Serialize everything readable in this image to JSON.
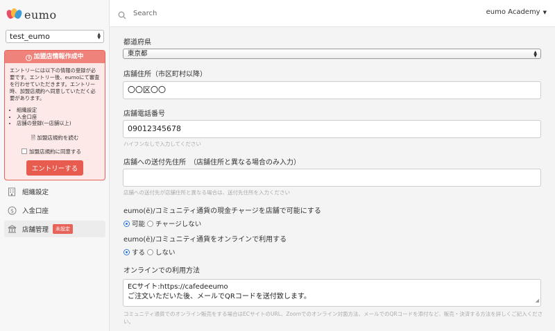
{
  "brand": {
    "name": "eumo"
  },
  "sidebar": {
    "org_select": "test_eumo",
    "notice": {
      "title": "加盟店情報作成中",
      "body": "エントリーには以下の情報の登録が必要です。エントリー後、eumoにて審査を行わせていただきます。エントリー時、加盟店規約へ同意していただく必要があります。",
      "items": [
        "組織設定",
        "入金口座",
        "店舗の登録(一店舗以上)"
      ],
      "terms_link": "加盟店規約を読む",
      "agree_label": "加盟店規約に同意する",
      "entry_button": "エントリーする"
    },
    "nav": [
      {
        "label": "組織設定",
        "icon": "building-icon"
      },
      {
        "label": "入金口座",
        "icon": "dollar-coin-icon"
      },
      {
        "label": "店舗管理",
        "icon": "store-icon",
        "badge": "未設定"
      }
    ]
  },
  "topbar": {
    "search_placeholder": "Search",
    "account": "eumo Academy"
  },
  "form": {
    "prefecture": {
      "label": "都道府県",
      "value": "東京都"
    },
    "address": {
      "label": "店舗住所（市区町村以降）",
      "value": "〇〇区〇〇"
    },
    "phone": {
      "label": "店舗電話番号",
      "value": "09012345678",
      "help": "ハイフンなしで入力してください"
    },
    "shipping": {
      "label": "店舗への送付先住所　（店舗住所と異なる場合のみ入力）",
      "value": "",
      "help": "店舗への送付先が店舗住所と異なる場合は、送付先住所を入力ください"
    },
    "cash_charge": {
      "label": "eumo(ё)/コミュニティ通貨の現金チャージを店舗で可能にする",
      "options": [
        "可能",
        "チャージしない"
      ],
      "selected": "可能"
    },
    "online": {
      "label": "eumo(ё)/コミュニティ通貨をオンラインで利用する",
      "options": [
        "する",
        "しない"
      ],
      "selected": "する"
    },
    "online_method": {
      "label": "オンラインでの利用方法",
      "line1": "ECサイト:https://cafedeeumo",
      "line2": "ご注文いただいた後、メールでQRコードを送付致します。",
      "help": "コミュニティ通貨でのオンライン販売をする場合はECサイトのURL、Zoomでのオンライン対面方法、メールでのQRコードを添付など、販売・決済する方法を詳しくご記入ください。"
    }
  },
  "colors": {
    "accent": "#e8625a",
    "radio": "#2d76d8"
  }
}
